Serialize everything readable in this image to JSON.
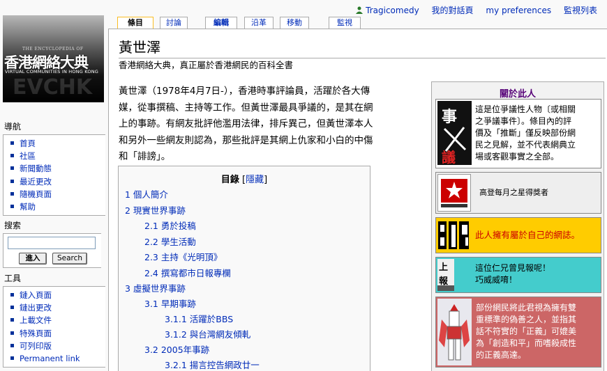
{
  "personal": {
    "username": "Tragicomedy",
    "links": [
      "我的對話頁",
      "my preferences",
      "監視列表"
    ]
  },
  "logo": {
    "en_top": "THE ENCYCLOPEDIA OF",
    "zh_title": "香港網絡大典",
    "en_bottom": "VIRTUAL COMMUNITIES IN HONG KONG"
  },
  "tabs": [
    "條目",
    "討論",
    "編輯",
    "沿革",
    "移動",
    "監視"
  ],
  "page": {
    "title": "黃世澤",
    "site_sub": "香港網絡大典，真正屬於香港網民的百科全書",
    "intro_lines": [
      "黃世澤（1978年4月7日-），香港時事評論員，活躍於各大傳",
      "媒，從事撰稿、主持等工作。但黃世澤最具爭議的，是其在網",
      "上的事跡。有網友批評他濫用法律，排斥異己，但黃世澤本人",
      "和另外一些網友則認為，那些批評是其網上仇家和小白的中傷",
      "和「誹謗」。"
    ]
  },
  "toc": {
    "title": "目錄",
    "toggle": "隱藏",
    "entries": [
      "1 個人簡介",
      "2 現實世界事跡",
      "2.1 勇於投稿",
      "2.2 學生活動",
      "2.3 主持《光明頂》",
      "2.4 撰寫都市日報專欄",
      "3 虛擬世界事跡",
      "3.1 早期事跡",
      "3.1.1 活躍於BBS",
      "3.1.2 與台灣網友傾軋",
      "3.2 2005年事跡",
      "3.2.1 揚言控告網政廿一"
    ]
  },
  "infobox": {
    "title": "關於此人",
    "controversial_lines": [
      "這是位爭議性人物〔或相關",
      "之爭議事件〕。條目內的評",
      "價及「推斷」僅反映部份網",
      "民之見解，並不代表網典立",
      "場或客觀事實之全部。"
    ],
    "controversial_pic": "事議",
    "star_award": "高登每月之星得獎者",
    "blog_text": "此人擁有屬於自己的網誌。",
    "report_lines": [
      "這位仁兄曾見報呢！",
      "巧威威唷！"
    ],
    "report_pic": "上報",
    "hypocrite_lines": [
      "部份網民將此君視為擁有雙",
      "重標準的偽善之人，並指其",
      "話不符實的「正義」可媲美",
      "為「創造和平」而嗜殺成性",
      "的正義高達。"
    ],
    "colors": {
      "controversial_bg": "#ffffff",
      "star_bg": "#eeeeee",
      "blog_bg": "#ffcc00",
      "report_bg": "#44cccc",
      "hypocrite_bg": "#cc6666"
    }
  },
  "sidebar": {
    "nav_title": "導航",
    "nav_items": [
      "首頁",
      "社區",
      "新聞動態",
      "最近更改",
      "隨機頁面",
      "幫助"
    ],
    "search_title": "搜索",
    "search_value": "",
    "go_label": "進入",
    "search_label": "Search",
    "toolbox_title": "工具",
    "toolbox_items": [
      "鏈入頁面",
      "鏈出更改",
      "上載文件",
      "特殊頁面",
      "可列印版",
      "Permanent link"
    ]
  }
}
